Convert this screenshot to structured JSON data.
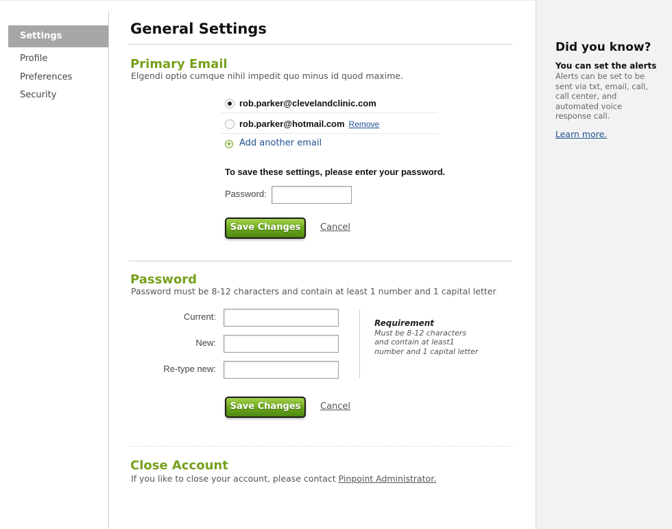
{
  "sidebar": {
    "items": [
      {
        "label": "Settings",
        "active": true
      },
      {
        "label": "Profile",
        "active": false
      },
      {
        "label": "Preferences",
        "active": false
      },
      {
        "label": "Security",
        "active": false
      }
    ]
  },
  "main": {
    "title": "General Settings",
    "primary_email": {
      "title": "Primary Email",
      "description": "Elgendi optio cumque nihil impedit quo minus id quod maxime.",
      "emails": [
        {
          "address": "rob.parker@clevelandclinic.com",
          "selected": true
        },
        {
          "address": "rob.parker@hotmail.com",
          "selected": false,
          "remove_label": "Remove"
        }
      ],
      "add_email_label": "Add another email",
      "password_note": "To save these settings, please enter your password.",
      "password_label": "Password:",
      "password_value": "",
      "save_label": "Save Changes",
      "cancel_label": "Cancel"
    },
    "password": {
      "title": "Password",
      "description": "Password must be 8-12 characters and contain at least 1 number and 1 capital letter",
      "current_label": "Current:",
      "new_label": "New:",
      "retype_label": "Re-type new:",
      "current_value": "",
      "new_value": "",
      "retype_value": "",
      "requirement_title": "Requirement",
      "requirement_lines": [
        "Must be 8-12 characters",
        "and contain at least1",
        "number and 1 capital letter"
      ],
      "save_label": "Save Changes",
      "cancel_label": "Cancel"
    },
    "close_account": {
      "title": "Close Account",
      "description_prefix": "If you like to close your account, please contact",
      "admin_link": "Pinpoint Administrator."
    }
  },
  "right_panel": {
    "title": "Did you know?",
    "subtitle": "You can set the alerts",
    "body_lines": [
      "Alerts can be set to be",
      "sent via txt, email, call,",
      "call center, and",
      "automated voice",
      "response call."
    ],
    "link": "Learn more."
  },
  "colors": {
    "accent_green": "#76a01d",
    "link_blue": "#1d4f8f",
    "sidebar_active": "#a6a6a6",
    "right_panel_bg": "#f2f2f2"
  }
}
